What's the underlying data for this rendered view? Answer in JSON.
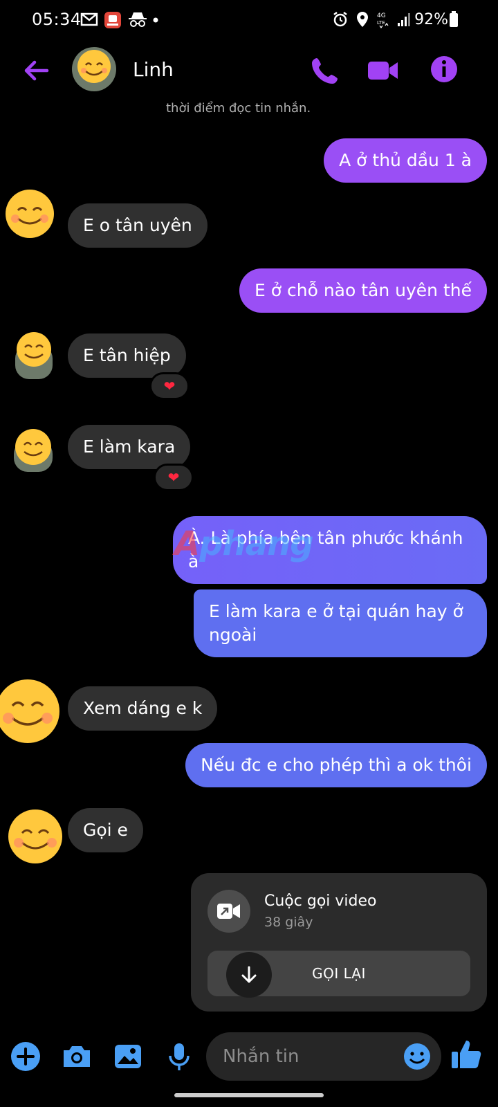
{
  "status_bar": {
    "time": "05:34",
    "battery": "92%",
    "icons_left": [
      "gmail-icon",
      "app-icon",
      "incognito-icon",
      "dot-icon"
    ],
    "icons_right": [
      "alarm-icon",
      "location-icon",
      "4g-lte-icon",
      "signal-icon",
      "battery-icon"
    ]
  },
  "header": {
    "contact_name": "Linh",
    "actions": [
      "phone-icon",
      "video-icon",
      "info-icon"
    ]
  },
  "read_hint": "thời điểm đọc tin nhắn.",
  "messages": [
    {
      "id": "m1",
      "direction": "out",
      "text": "A ở thủ dầu 1 à"
    },
    {
      "id": "m2",
      "direction": "in",
      "text": "E o tân uyên"
    },
    {
      "id": "m3",
      "direction": "out",
      "text": "E ở chỗ nào tân uyên thế"
    },
    {
      "id": "m4",
      "direction": "in",
      "text": "E tân hiệp",
      "reaction": "❤"
    },
    {
      "id": "m5",
      "direction": "in",
      "text": "E làm kara",
      "reaction": "❤"
    },
    {
      "id": "m6",
      "direction": "out",
      "text": "À. Là phía bên tân phước khánh à"
    },
    {
      "id": "m7",
      "direction": "out",
      "text": "E làm kara e ở tại quán hay ở ngoài"
    },
    {
      "id": "m8",
      "direction": "in",
      "text": "Xem dáng e k"
    },
    {
      "id": "m9",
      "direction": "out",
      "text": "Nếu đc e cho phép thì a ok thôi"
    },
    {
      "id": "m10",
      "direction": "in",
      "text": "Gọi e"
    }
  ],
  "watermark": {
    "first": "A",
    "rest": "phang"
  },
  "call_card": {
    "title": "Cuộc gọi video",
    "duration": "38 giây",
    "button_label": "GỌI LẠI"
  },
  "composer": {
    "placeholder": "Nhắn tin"
  },
  "colors": {
    "outgoing_purple": "#9a4ff5",
    "outgoing_blue": "#6a6bf5",
    "incoming": "#303030",
    "accent": "#a142f4",
    "composer_accent": "#4a9ff5"
  }
}
